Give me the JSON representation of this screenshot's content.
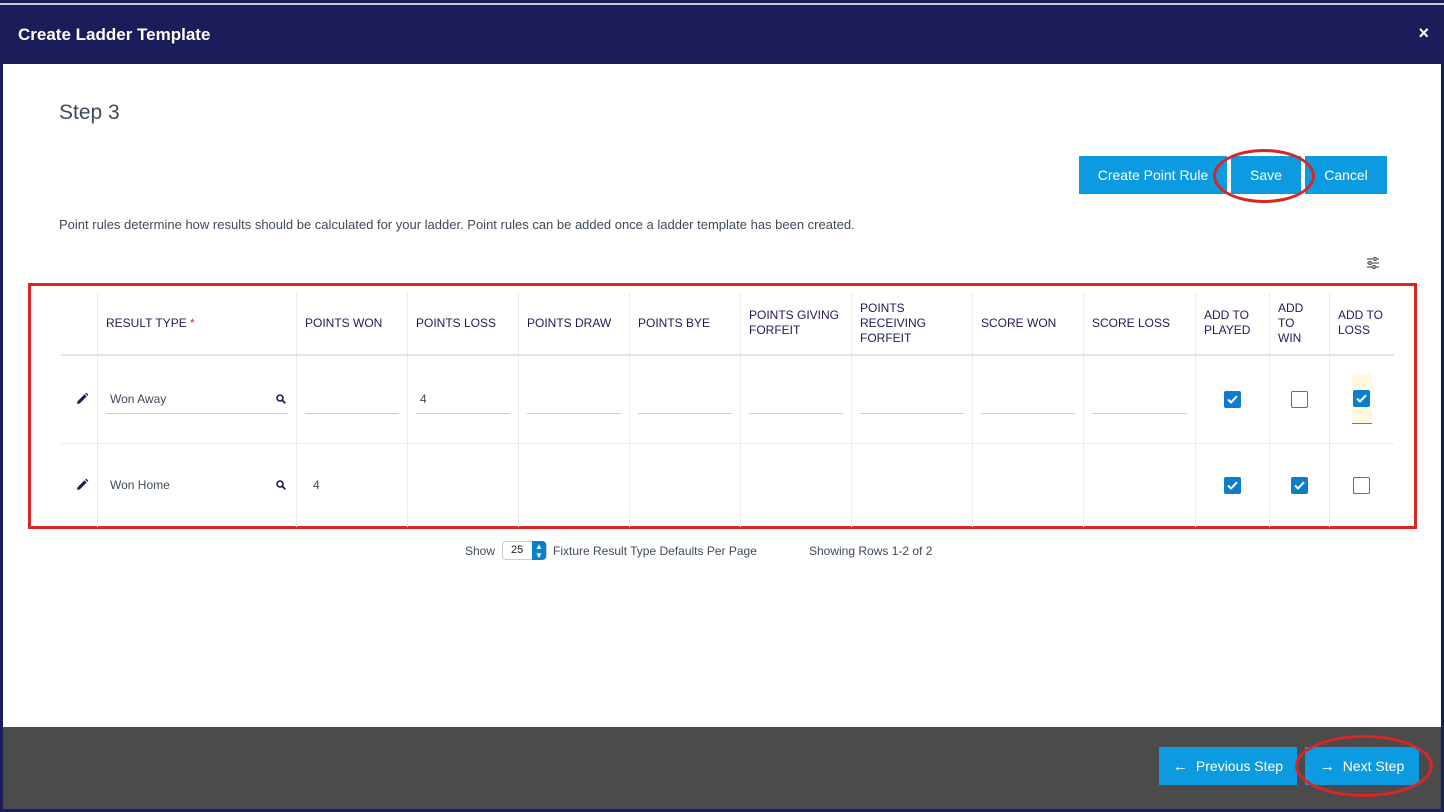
{
  "modal": {
    "title": "Create Ladder Template",
    "close_glyph": "×"
  },
  "step": {
    "title": "Step 3"
  },
  "toolbar": {
    "create_point_rule_label": "Create Point Rule",
    "save_label": "Save",
    "cancel_label": "Cancel"
  },
  "info_text": "Point rules determine how results should be calculated for your ladder. Point rules can be added once a ladder template has been created.",
  "table": {
    "columns": [
      "RESULT TYPE",
      "POINTS WON",
      "POINTS LOSS",
      "POINTS DRAW",
      "POINTS BYE",
      "POINTS GIVING FORFEIT",
      "POINTS RECEIVING FORFEIT",
      "SCORE WON",
      "SCORE LOSS",
      "ADD TO PLAYED",
      "ADD TO WIN",
      "ADD TO LOSS"
    ],
    "required_marker": "*",
    "rows": [
      {
        "result_type": "Won Away",
        "points_won": "",
        "points_loss": "4",
        "points_draw": "",
        "points_bye": "",
        "points_giving_forfeit": "",
        "points_receiving_forfeit": "",
        "score_won": "",
        "score_loss": "",
        "add_to_played": true,
        "add_to_win": false,
        "add_to_loss": true
      },
      {
        "result_type": "Won Home",
        "points_won": "4",
        "points_loss": "",
        "points_draw": "",
        "points_bye": "",
        "points_giving_forfeit": "",
        "points_receiving_forfeit": "",
        "score_won": "",
        "score_loss": "",
        "add_to_played": true,
        "add_to_win": true,
        "add_to_loss": false
      }
    ]
  },
  "pager": {
    "show_label": "Show",
    "page_size": "25",
    "per_page_label": "Fixture Result Type Defaults Per Page",
    "rows_label": "Showing Rows 1-2 of 2"
  },
  "footer": {
    "previous_label": "Previous Step",
    "next_label": "Next Step"
  },
  "colors": {
    "header_bg": "#1b1c5a",
    "accent": "#0c9be0",
    "annotation_red": "#d92626",
    "footer_bg": "#4b4b4b"
  },
  "icons": [
    "close-icon",
    "pencil-icon",
    "search-icon",
    "settings-sliders-icon",
    "check-icon",
    "arrow-left-icon",
    "arrow-right-icon"
  ]
}
